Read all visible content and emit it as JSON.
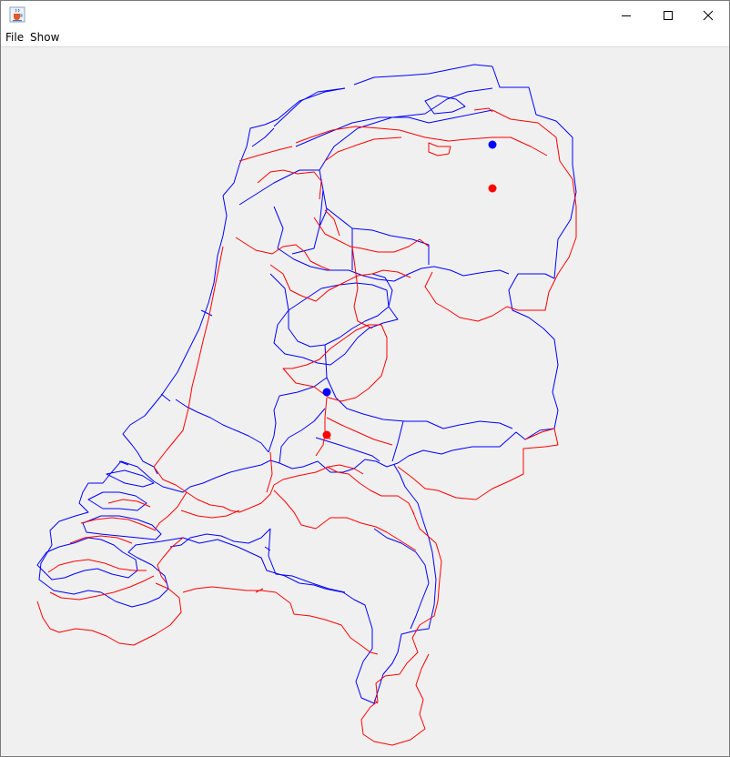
{
  "window": {
    "app_icon": "java-coffee-cup-icon",
    "controls": {
      "minimize_icon": "minimize-icon",
      "maximize_icon": "maximize-icon",
      "close_icon": "close-icon"
    }
  },
  "menu": {
    "items": [
      "File",
      "Show"
    ]
  },
  "map": {
    "colors": {
      "series_a": "#0000ff",
      "series_b": "#ff0000"
    },
    "markers": [
      {
        "name": "blue-north",
        "color": "#0000ff"
      },
      {
        "name": "red-north",
        "color": "#ff0000"
      },
      {
        "name": "blue-center",
        "color": "#0000ff"
      },
      {
        "name": "red-center",
        "color": "#ff0000"
      }
    ]
  }
}
